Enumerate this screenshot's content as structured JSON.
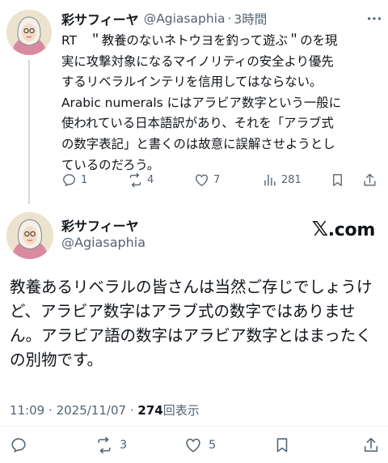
{
  "tweet1": {
    "name": "彩サフィーヤ",
    "handle": "@Agiasaphia",
    "dot": "·",
    "time": "3時間",
    "lines": [
      "RT　＂教養のないネトウヨを釣って遊ぶ＂のを現",
      "実に攻撃対象になるマイノリティの安全より優先",
      "するリベラルインテリを信用してはならない。",
      "Arabic numerals にはアラビア数字という一般に",
      "使われている日本語訳があり、それを「アラブ式",
      "の数字表記」と書くのは故意に誤解させようとし",
      "ているのだろう。"
    ],
    "actions": {
      "replies": "1",
      "reposts": "4",
      "likes": "7",
      "views": "281"
    }
  },
  "tweet2": {
    "name": "彩サフィーヤ",
    "handle": "@Agiasaphia",
    "brand": ".com",
    "brand_x": "𝕏",
    "lines": [
      "教養あるリベラルの皆さんは当然ご存じでしょうけ",
      "ど、アラビア数字はアラブ式の数字ではありませ",
      "ん。アラビア語の数字はアラビア数字とはまったく",
      "の別物です。"
    ],
    "meta": {
      "time": "11:09",
      "sep": "·",
      "date": "2025/11/07",
      "sep2": "·",
      "views_count": "274",
      "views_label": "回表示"
    },
    "actions": {
      "reposts": "3",
      "likes": "5"
    }
  },
  "colors": {
    "text": "#0f1419",
    "secondary": "#536471",
    "line": "#cfd9de"
  },
  "icons": [
    "more-icon",
    "reply-icon",
    "repost-icon",
    "like-icon",
    "views-icon",
    "bookmark-icon",
    "share-icon"
  ]
}
